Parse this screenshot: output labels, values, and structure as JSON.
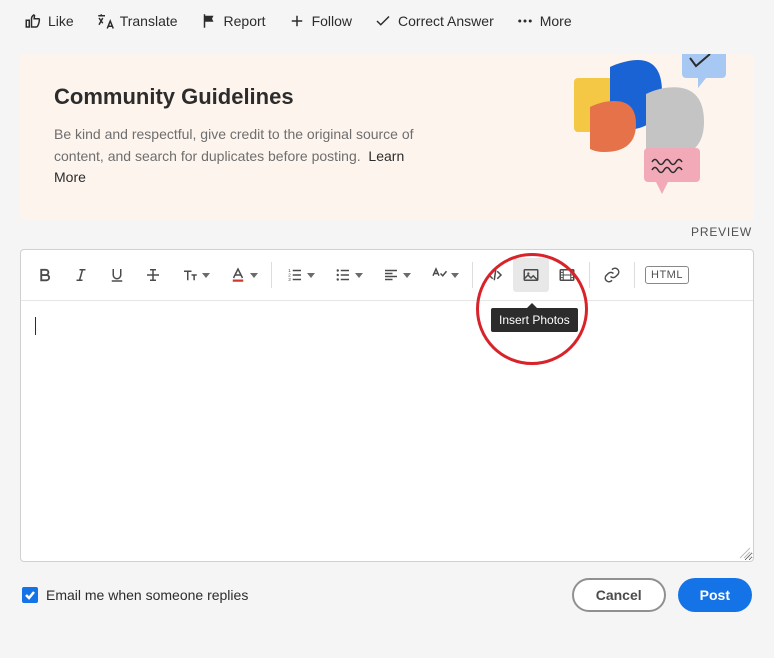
{
  "topbar": {
    "like": "Like",
    "translate": "Translate",
    "report": "Report",
    "follow": "Follow",
    "correct": "Correct Answer",
    "more": "More"
  },
  "guidelines": {
    "title": "Community Guidelines",
    "text": "Be kind and respectful, give credit to the original source of content, and search for duplicates before posting.",
    "learn_more": "Learn More"
  },
  "preview_label": "PREVIEW",
  "toolbar": {
    "bold": "Bold",
    "italic": "Italic",
    "underline": "Underline",
    "strike": "Strikethrough",
    "textsize": "Text Size",
    "textcolor": "Text Color",
    "ol": "Ordered List",
    "ul": "Unordered List",
    "align": "Align",
    "spellcheck": "Spell Check",
    "code": "Code",
    "photos": "Insert Photos",
    "video": "Insert Video",
    "link": "Link",
    "html": "HTML"
  },
  "tooltip": "Insert Photos",
  "footer": {
    "email_me": "Email me when someone replies",
    "cancel": "Cancel",
    "post": "Post",
    "checked": true
  }
}
